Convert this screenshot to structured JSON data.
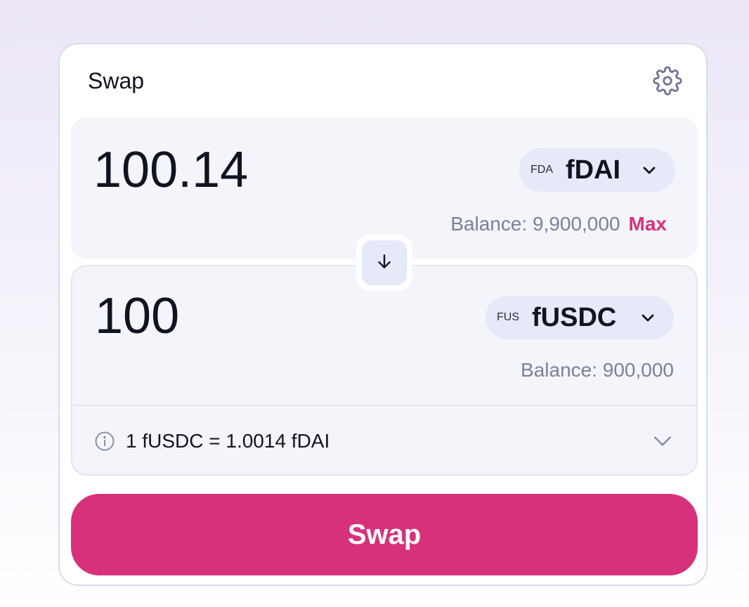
{
  "header": {
    "title": "Swap",
    "settings_icon": "gear-icon"
  },
  "from": {
    "amount": "100.14",
    "token_icon_text": "FDA",
    "token_symbol": "fDAI",
    "balance": "Balance: 9,900,000",
    "max_label": "Max"
  },
  "switch": {
    "icon": "arrow-down-icon"
  },
  "to": {
    "amount": "100",
    "token_icon_text": "FUS",
    "token_symbol": "fUSDC",
    "balance": "Balance: 900,000"
  },
  "rate": {
    "text": "1 fUSDC = 1.0014 fDAI",
    "info_icon": "info-icon",
    "expand_icon": "chevron-down-icon"
  },
  "actions": {
    "swap_label": "Swap"
  },
  "colors": {
    "accent": "#d8317b",
    "panel": "#f4f5fa",
    "token_pill": "#e6e9f8",
    "muted_text": "#7a8199",
    "border": "#d6dceb"
  }
}
